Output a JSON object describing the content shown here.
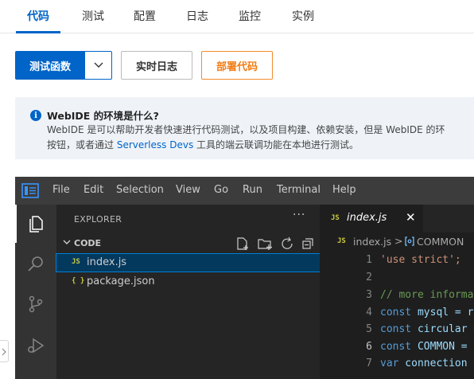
{
  "tabs": [
    {
      "label": "代码",
      "active": true
    },
    {
      "label": "测试",
      "active": false
    },
    {
      "label": "配置",
      "active": false
    },
    {
      "label": "日志",
      "active": false
    },
    {
      "label": "监控",
      "active": false
    },
    {
      "label": "实例",
      "active": false
    }
  ],
  "toolbar": {
    "test_label": "测试函数",
    "realtime_log_label": "实时日志",
    "deploy_label": "部署代码"
  },
  "notice": {
    "icon": "info-icon",
    "icon_glyph": "i",
    "title": "WebIDE 的环境是什么?",
    "line1": "WebIDE 是可以帮助开发者快速进行代码测试，以及项目构建、依赖安装，但是 WebIDE 的环",
    "line2_pre": "按钮，或者通过 ",
    "line2_link": "Serverless Devs",
    "line2_post": " 工具的端云联调功能在本地进行测试。"
  },
  "ide": {
    "menu": [
      "File",
      "Edit",
      "Selection",
      "View",
      "Go",
      "Run",
      "Terminal",
      "Help"
    ],
    "explorer": {
      "title": "EXPLORER",
      "more": "···",
      "section": "CODE",
      "files": [
        {
          "badge": "JS",
          "name": "index.js",
          "selected": true
        },
        {
          "badge": "{ }",
          "name": "package.json",
          "selected": false
        }
      ]
    },
    "editor": {
      "tab": {
        "badge": "JS",
        "name": "index.js",
        "close": "✕"
      },
      "breadcrumb": {
        "badge": "JS",
        "file": "index.js",
        "sep": ">",
        "symbol": "COMMON"
      },
      "lines": [
        {
          "n": "1",
          "text": "'use strict';"
        },
        {
          "n": "2",
          "text": ""
        },
        {
          "n": "3",
          "text": "// more information"
        },
        {
          "n": "4",
          "text": "const mysql = req"
        },
        {
          "n": "5",
          "text": "const circular = "
        },
        {
          "n": "6",
          "text": "const COMMON = {"
        },
        {
          "n": "7",
          "text": "var connection = "
        }
      ]
    }
  },
  "colors": {
    "primary": "#0064c8",
    "warning": "#f07d14",
    "vscode_bg": "#1e1e1e",
    "vscode_sidebar": "#252526"
  }
}
